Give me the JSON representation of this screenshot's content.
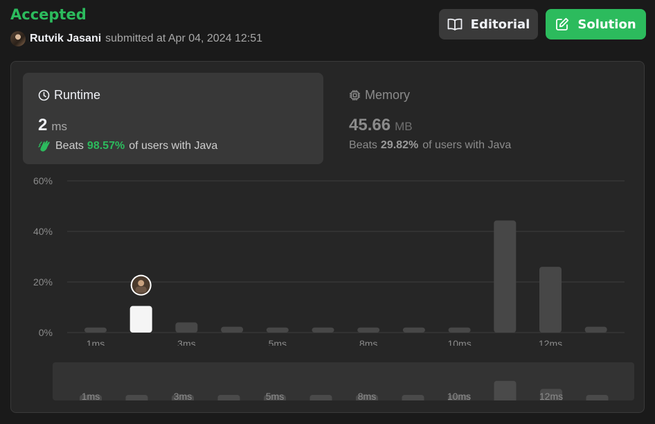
{
  "header": {
    "status": "Accepted",
    "username": "Rutvik Jasani",
    "submitted_text": "submitted at Apr 04, 2024 12:51",
    "editorial_label": "Editorial",
    "solution_label": "Solution"
  },
  "runtime": {
    "title": "Runtime",
    "value": "2",
    "unit": "ms",
    "beats_prefix": "Beats",
    "beats_pct": "98.57%",
    "beats_suffix": "of users with Java"
  },
  "memory": {
    "title": "Memory",
    "value": "45.66",
    "unit": "MB",
    "beats_prefix": "Beats",
    "beats_pct": "29.82%",
    "beats_suffix": "of users with Java"
  },
  "colors": {
    "accent_green": "#2cbb5d",
    "bar_default": "#474747",
    "bar_highlight": "#f5f5f5"
  },
  "chart_data": {
    "type": "bar",
    "ylim": [
      0,
      60
    ],
    "yticks": [
      "0%",
      "20%",
      "40%",
      "60%"
    ],
    "ytick_values": [
      0,
      20,
      40,
      60
    ],
    "values": [
      2,
      10.5,
      4,
      2.3,
      2,
      2,
      2,
      2,
      2,
      44.3,
      26,
      2.3
    ],
    "highlight_index": 1,
    "xtick_labels": [
      {
        "index": 0,
        "label": "1ms"
      },
      {
        "index": 2,
        "label": "3ms"
      },
      {
        "index": 4,
        "label": "5ms"
      },
      {
        "index": 6,
        "label": "8ms"
      },
      {
        "index": 8,
        "label": "10ms"
      },
      {
        "index": 10,
        "label": "12ms"
      }
    ],
    "overview_labels": [
      {
        "index": 0,
        "label": "1ms"
      },
      {
        "index": 2,
        "label": "3ms"
      },
      {
        "index": 4,
        "label": "5ms"
      },
      {
        "index": 6,
        "label": "8ms"
      },
      {
        "index": 8,
        "label": "10ms"
      },
      {
        "index": 10,
        "label": "12ms"
      }
    ]
  }
}
